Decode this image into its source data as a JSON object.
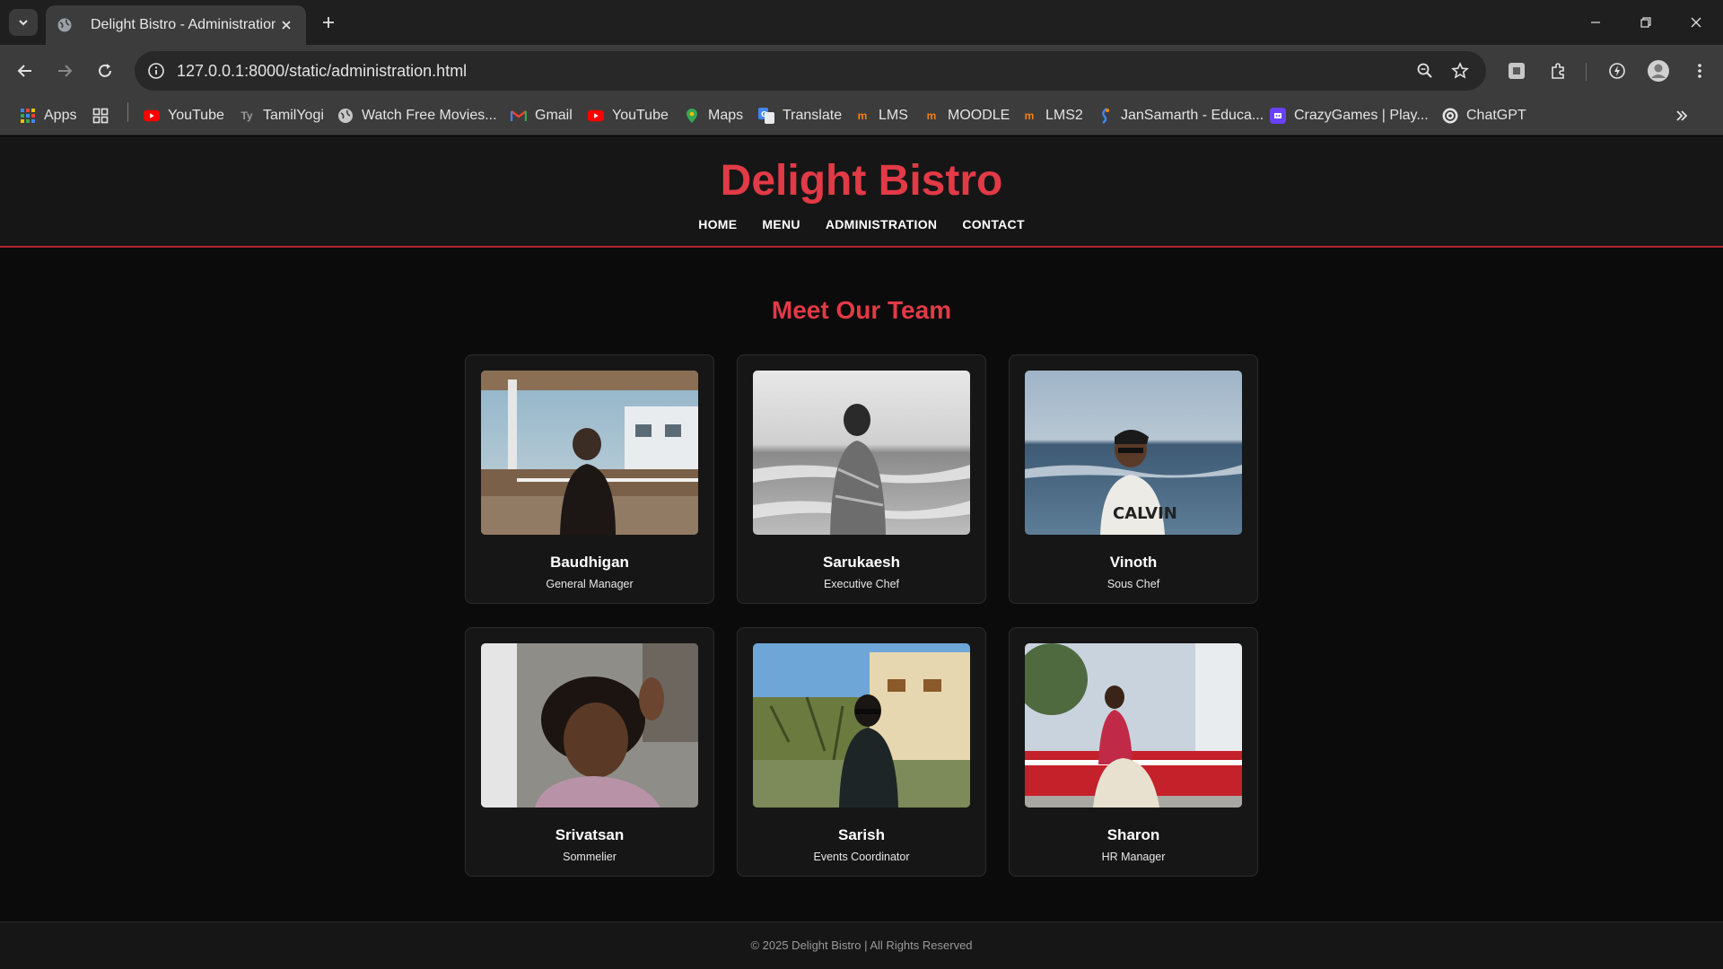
{
  "browser": {
    "tab_title": "Delight Bistro - Administration",
    "url": "127.0.0.1:8000/static/administration.html",
    "bookmarks": [
      {
        "label": "Apps",
        "icon": "apps-grid-icon"
      },
      {
        "label": "YouTube",
        "icon": "youtube-icon"
      },
      {
        "label": "TamilYogi",
        "icon": "tamilyogi-icon"
      },
      {
        "label": "Watch Free Movies...",
        "icon": "globe-icon"
      },
      {
        "label": "Gmail",
        "icon": "gmail-icon"
      },
      {
        "label": "YouTube",
        "icon": "youtube-icon"
      },
      {
        "label": "Maps",
        "icon": "maps-icon"
      },
      {
        "label": "Translate",
        "icon": "translate-icon"
      },
      {
        "label": "LMS",
        "icon": "moodle-icon"
      },
      {
        "label": "MOODLE",
        "icon": "moodle-icon"
      },
      {
        "label": "LMS2",
        "icon": "moodle-icon"
      },
      {
        "label": "JanSamarth - Educa...",
        "icon": "jansamarth-icon"
      },
      {
        "label": "CrazyGames | Play...",
        "icon": "crazygames-icon"
      },
      {
        "label": "ChatGPT",
        "icon": "chatgpt-icon"
      }
    ]
  },
  "site": {
    "brand": "Delight Bistro",
    "nav": [
      "HOME",
      "MENU",
      "ADMINISTRATION",
      "CONTACT"
    ],
    "accent_color": "#e23a46"
  },
  "team": {
    "title": "Meet Our Team",
    "members": [
      {
        "name": "Baudhigan",
        "role": "General Manager"
      },
      {
        "name": "Sarukaesh",
        "role": "Executive Chef"
      },
      {
        "name": "Vinoth",
        "role": "Sous Chef"
      },
      {
        "name": "Srivatsan",
        "role": "Sommelier"
      },
      {
        "name": "Sarish",
        "role": "Events Coordinator"
      },
      {
        "name": "Sharon",
        "role": "HR Manager"
      }
    ]
  },
  "footer": {
    "text": "© 2025 Delight Bistro | All Rights Reserved"
  }
}
